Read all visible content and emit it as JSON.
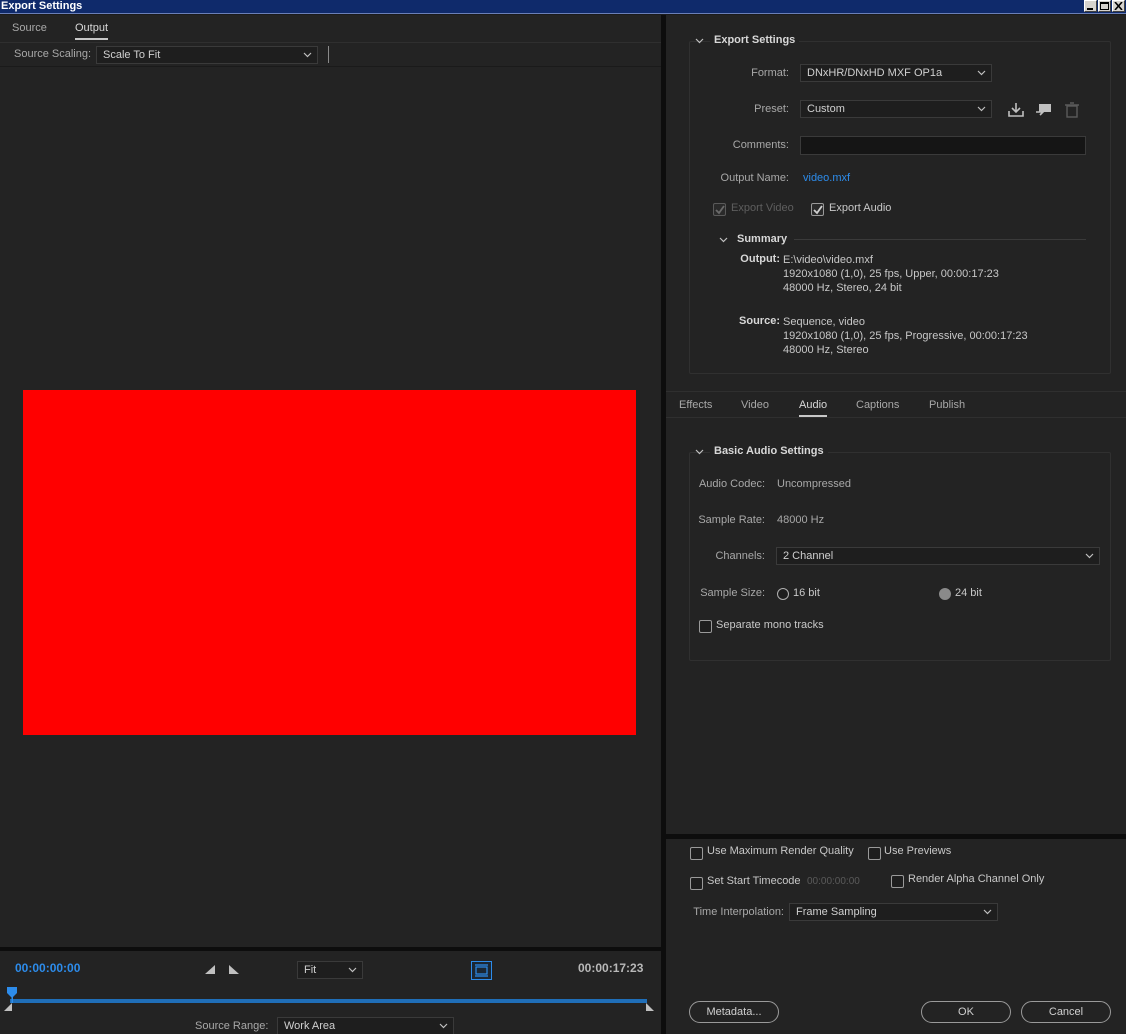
{
  "window": {
    "title": "Export Settings"
  },
  "left": {
    "tabs": [
      {
        "label": "Source"
      },
      {
        "label": "Output"
      }
    ],
    "source_scaling": {
      "label": "Source Scaling:",
      "value": "Scale To Fit"
    },
    "preview_color": "#ff0000",
    "timecode_start": "00:00:00:00",
    "timecode_end": "00:00:17:23",
    "zoom": "Fit",
    "source_range": {
      "label": "Source Range:",
      "value": "Work Area"
    }
  },
  "export_settings": {
    "title": "Export Settings",
    "format": {
      "label": "Format:",
      "value": "DNxHR/DNxHD MXF OP1a"
    },
    "preset": {
      "label": "Preset:",
      "value": "Custom"
    },
    "comments": {
      "label": "Comments:",
      "value": ""
    },
    "output_name": {
      "label": "Output Name:",
      "value": "video.mxf"
    },
    "export_video": {
      "label": "Export Video",
      "checked": true,
      "disabled": true
    },
    "export_audio": {
      "label": "Export Audio",
      "checked": true
    },
    "summary": {
      "title": "Summary",
      "output_label": "Output:",
      "output_lines": [
        "E:\\video\\video.mxf",
        "1920x1080 (1,0), 25 fps, Upper, 00:00:17:23",
        "48000 Hz, Stereo, 24 bit"
      ],
      "source_label": "Source:",
      "source_lines": [
        "Sequence, video",
        "1920x1080 (1,0), 25 fps, Progressive, 00:00:17:23",
        "48000 Hz, Stereo"
      ]
    }
  },
  "settings_tabs": [
    {
      "label": "Effects"
    },
    {
      "label": "Video"
    },
    {
      "label": "Audio"
    },
    {
      "label": "Captions"
    },
    {
      "label": "Publish"
    }
  ],
  "audio": {
    "title": "Basic Audio Settings",
    "codec": {
      "label": "Audio Codec:",
      "value": "Uncompressed"
    },
    "sample_rate": {
      "label": "Sample Rate:",
      "value": "48000 Hz"
    },
    "channels": {
      "label": "Channels:",
      "value": "2 Channel"
    },
    "sample_size": {
      "label": "Sample Size:",
      "opt1": "16 bit",
      "opt2": "24 bit",
      "selected": "24 bit"
    },
    "separate_mono": {
      "label": "Separate mono tracks",
      "checked": false
    }
  },
  "bottom_options": {
    "max_render": "Use Maximum Render Quality",
    "use_previews": "Use Previews",
    "set_start_tc": "Set Start Timecode",
    "start_tc_value": "00:00:00:00",
    "alpha_only": "Render Alpha Channel Only",
    "time_interp": {
      "label": "Time Interpolation:",
      "value": "Frame Sampling"
    }
  },
  "buttons": {
    "metadata": "Metadata...",
    "ok": "OK",
    "cancel": "Cancel"
  },
  "colors": {
    "accent": "#2d8ceb",
    "panel": "#232323",
    "preview": "#ff0000"
  }
}
